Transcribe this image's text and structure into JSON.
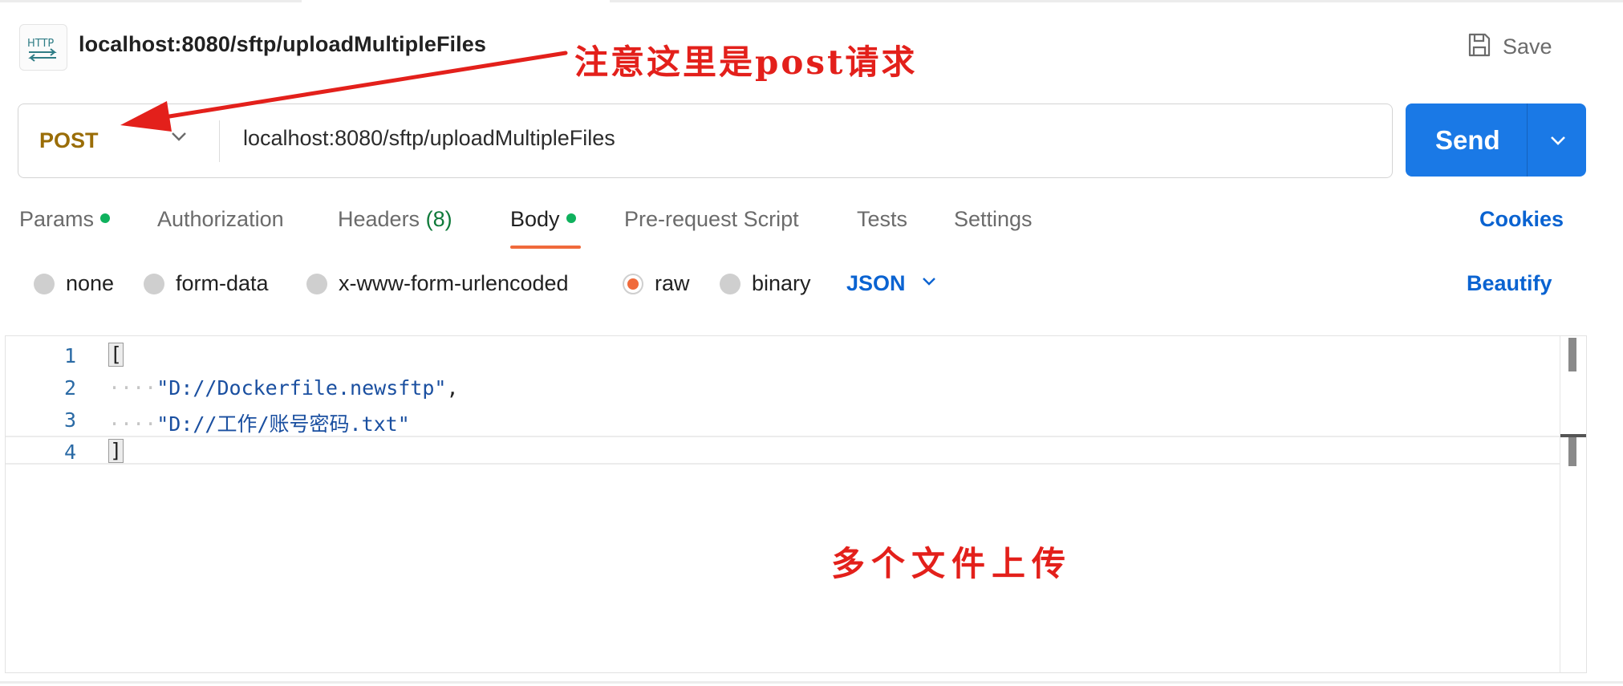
{
  "request": {
    "icon_label": "HTTP",
    "title": "localhost:8080/sftp/uploadMultipleFiles",
    "save_label": "Save"
  },
  "url_bar": {
    "method": "POST",
    "url": "localhost:8080/sftp/uploadMultipleFiles",
    "send_label": "Send"
  },
  "tabs": [
    {
      "label": "Params",
      "dot": true
    },
    {
      "label": "Authorization"
    },
    {
      "label": "Headers",
      "count": "(8)"
    },
    {
      "label": "Body",
      "dot": true,
      "active": true
    },
    {
      "label": "Pre-request Script"
    },
    {
      "label": "Tests"
    },
    {
      "label": "Settings"
    }
  ],
  "cookies_label": "Cookies",
  "body_types": [
    {
      "label": "none"
    },
    {
      "label": "form-data"
    },
    {
      "label": "x-www-form-urlencoded"
    },
    {
      "label": "raw",
      "selected": true
    },
    {
      "label": "binary"
    }
  ],
  "raw_format": "JSON",
  "beautify_label": "Beautify",
  "editor": {
    "line_numbers": [
      "1",
      "2",
      "3",
      "4"
    ],
    "lines": [
      {
        "indent": "",
        "text": "["
      },
      {
        "indent": "····",
        "text": "\"D://Dockerfile.newsftp\"",
        "trail": ","
      },
      {
        "indent": "····",
        "text": "\"D://工作/账号密码.txt\""
      },
      {
        "indent": "",
        "text": "]"
      }
    ]
  },
  "annotations": {
    "method_note": "注意这里是post请求",
    "body_note": "多个文件上传"
  },
  "colors": {
    "accent_blue": "#1a79e6",
    "link_blue": "#0a63d1",
    "method_post": "#9a6d07",
    "active_orange": "#f06a3b",
    "dot_green": "#0fb15d",
    "annotation_red": "#e3201b"
  }
}
